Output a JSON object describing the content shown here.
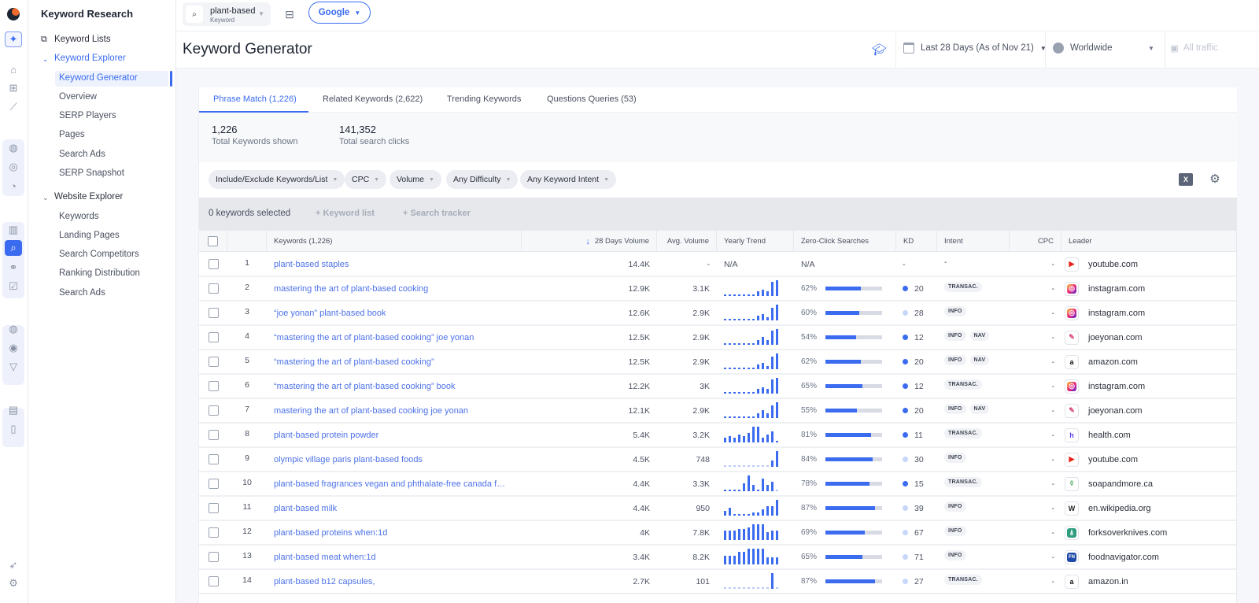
{
  "app": {
    "section_title": "Keyword Research"
  },
  "rail": {
    "icons": [
      "logo",
      "ai-sparkle-icon",
      "home-icon",
      "dashboard-add-icon",
      "trend-chart-icon",
      "globe-icon",
      "globe-trend-icon",
      "pie-chart-icon",
      "bar-chart-icon",
      "keyword-research-icon",
      "link-icon",
      "report-check-icon",
      "globe-search-icon",
      "search-target-icon",
      "funnel-icon",
      "report-chart-icon",
      "clipboard-icon",
      "rocket-icon",
      "settings-icon"
    ]
  },
  "nav": {
    "keyword_lists": "Keyword Lists",
    "keyword_explorer": "Keyword Explorer",
    "keyword_explorer_items": [
      "Keyword Generator",
      "Overview",
      "SERP Players",
      "Pages",
      "Search Ads",
      "SERP Snapshot"
    ],
    "website_explorer": "Website Explorer",
    "website_explorer_items": [
      "Keywords",
      "Landing Pages",
      "Search Competitors",
      "Ranking Distribution",
      "Search Ads"
    ],
    "active_item": "Keyword Generator"
  },
  "topbar": {
    "keyword_value": "plant-based",
    "keyword_label": "Keyword",
    "engine": "Google"
  },
  "header": {
    "title": "Keyword Generator",
    "date_range": "Last 28 Days (As of Nov 21)",
    "location": "Worldwide",
    "traffic": "All traffic"
  },
  "tabs": [
    {
      "label": "Phrase Match (1,226)",
      "active": true
    },
    {
      "label": "Related Keywords (2,622)",
      "active": false
    },
    {
      "label": "Trending Keywords",
      "active": false
    },
    {
      "label": "Questions Queries (53)",
      "active": false
    }
  ],
  "stats": [
    {
      "value": "1,226",
      "label": "Total Keywords shown"
    },
    {
      "value": "141,352",
      "label": "Total search clicks"
    }
  ],
  "filters": [
    "Include/Exclude Keywords/List",
    "CPC",
    "Volume",
    "Any Difficulty",
    "Any Keyword Intent"
  ],
  "selection": {
    "status": "0 keywords selected",
    "add_keyword_list": "+ Keyword list",
    "add_search_tracker": "+ Search tracker"
  },
  "table": {
    "columns": {
      "keywords": "Keywords (1,226)",
      "volume": "28 Days Volume",
      "avg_volume": "Avg. Volume",
      "trend": "Yearly Trend",
      "zero_click": "Zero-Click Searches",
      "kd": "KD",
      "intent": "Intent",
      "cpc": "CPC",
      "leader": "Leader"
    },
    "sort": {
      "column": "28 Days Volume",
      "direction": "desc"
    },
    "kd_colors": {
      "easy": "#3b6cf0",
      "medium": "#c7d6fb"
    },
    "rows": [
      {
        "n": "1",
        "keyword": "plant-based staples",
        "volume": "14.4K",
        "avg": "-",
        "trend": null,
        "trend_text": "N/A",
        "zero_click": null,
        "zero_click_text": "N/A",
        "kd": null,
        "kd_text": "-",
        "intent": [],
        "intent_text": "-",
        "cpc": "-",
        "leader": "youtube.com",
        "leader_icon": "youtube"
      },
      {
        "n": "2",
        "keyword": "mastering the art of plant-based cooking",
        "volume": "12.9K",
        "avg": "3.1K",
        "trend": [
          1,
          1,
          1,
          1,
          1,
          1,
          1,
          3,
          4,
          3,
          9,
          10
        ],
        "zero_click": 62,
        "kd": 20,
        "intent": [
          "TRANSAC."
        ],
        "cpc": "-",
        "leader": "instagram.com",
        "leader_icon": "instagram"
      },
      {
        "n": "3",
        "keyword": "“joe yonan” plant-based book",
        "volume": "12.6K",
        "avg": "2.9K",
        "trend": [
          1,
          1,
          1,
          1,
          1,
          1,
          1,
          3,
          4,
          2,
          8,
          10
        ],
        "zero_click": 60,
        "kd": 28,
        "intent": [
          "INFO"
        ],
        "cpc": "-",
        "leader": "instagram.com",
        "leader_icon": "instagram"
      },
      {
        "n": "4",
        "keyword": "“mastering the art of plant-based cooking” joe yonan",
        "volume": "12.5K",
        "avg": "2.9K",
        "trend": [
          1,
          1,
          1,
          1,
          1,
          1,
          1,
          3,
          5,
          3,
          9,
          10
        ],
        "zero_click": 54,
        "kd": 12,
        "intent": [
          "INFO",
          "NAV"
        ],
        "cpc": "-",
        "leader": "joeyonan.com",
        "leader_icon": "joeyonan"
      },
      {
        "n": "5",
        "keyword": "“mastering the art of plant-based cooking”",
        "volume": "12.5K",
        "avg": "2.9K",
        "trend": [
          1,
          1,
          1,
          1,
          1,
          1,
          1,
          3,
          4,
          2,
          8,
          10
        ],
        "zero_click": 62,
        "kd": 20,
        "intent": [
          "INFO",
          "NAV"
        ],
        "cpc": "-",
        "leader": "amazon.com",
        "leader_icon": "amazon"
      },
      {
        "n": "6",
        "keyword": "“mastering the art of plant-based cooking” book",
        "volume": "12.2K",
        "avg": "3K",
        "trend": [
          1,
          1,
          1,
          1,
          1,
          1,
          1,
          3,
          4,
          3,
          9,
          10
        ],
        "zero_click": 65,
        "kd": 12,
        "intent": [
          "TRANSAC."
        ],
        "cpc": "-",
        "leader": "instagram.com",
        "leader_icon": "instagram"
      },
      {
        "n": "7",
        "keyword": "mastering the art of plant-based cooking joe yonan",
        "volume": "12.1K",
        "avg": "2.9K",
        "trend": [
          1,
          1,
          1,
          1,
          1,
          1,
          1,
          3,
          5,
          3,
          8,
          10
        ],
        "zero_click": 55,
        "kd": 20,
        "intent": [
          "INFO",
          "NAV"
        ],
        "cpc": "-",
        "leader": "joeyonan.com",
        "leader_icon": "joeyonan"
      },
      {
        "n": "8",
        "keyword": "plant-based protein powder",
        "volume": "5.4K",
        "avg": "3.2K",
        "trend": [
          3,
          4,
          3,
          5,
          4,
          6,
          10,
          10,
          3,
          5,
          7,
          1
        ],
        "zero_click": 81,
        "kd": 11,
        "intent": [
          "TRANSAC."
        ],
        "cpc": "-",
        "leader": "health.com",
        "leader_icon": "health"
      },
      {
        "n": "9",
        "keyword": "olympic village paris plant-based foods",
        "volume": "4.5K",
        "avg": "748",
        "trend": [
          0,
          0,
          0,
          0,
          0,
          0,
          0,
          0,
          0,
          0,
          4,
          10
        ],
        "zero_click": 84,
        "kd": 30,
        "intent": [
          "INFO"
        ],
        "cpc": "-",
        "leader": "youtube.com",
        "leader_icon": "youtube"
      },
      {
        "n": "10",
        "keyword": "plant-based fragrances vegan and phthalate-free canada for c...",
        "volume": "4.4K",
        "avg": "3.3K",
        "trend": [
          1,
          1,
          1,
          1,
          5,
          10,
          4,
          1,
          8,
          4,
          6,
          0
        ],
        "zero_click": 78,
        "kd": 15,
        "intent": [
          "TRANSAC."
        ],
        "cpc": "-",
        "leader": "soapandmore.ca",
        "leader_icon": "soapandmore"
      },
      {
        "n": "11",
        "keyword": "plant-based milk",
        "volume": "4.4K",
        "avg": "950",
        "trend": [
          3,
          5,
          1,
          1,
          1,
          1,
          2,
          2,
          4,
          6,
          6,
          10
        ],
        "zero_click": 87,
        "kd": 39,
        "intent": [
          "INFO"
        ],
        "cpc": "-",
        "leader": "en.wikipedia.org",
        "leader_icon": "wikipedia"
      },
      {
        "n": "12",
        "keyword": "plant-based proteins when:1d",
        "volume": "4K",
        "avg": "7.8K",
        "trend": [
          6,
          6,
          6,
          7,
          7,
          8,
          10,
          10,
          10,
          5,
          6,
          6
        ],
        "zero_click": 69,
        "kd": 67,
        "intent": [
          "INFO"
        ],
        "cpc": "-",
        "leader": "forksoverknives.com",
        "leader_icon": "forksoverknives"
      },
      {
        "n": "13",
        "keyword": "plant-based meat when:1d",
        "volume": "3.4K",
        "avg": "8.2K",
        "trend": [
          5,
          5,
          5,
          7,
          7,
          9,
          9,
          9,
          9,
          4,
          4,
          4
        ],
        "zero_click": 65,
        "kd": 71,
        "intent": [
          "INFO"
        ],
        "cpc": "-",
        "leader": "foodnavigator.com",
        "leader_icon": "foodnavigator"
      },
      {
        "n": "14",
        "keyword": "plant-based b12 capsules,",
        "volume": "2.7K",
        "avg": "101",
        "trend": [
          0,
          0,
          0,
          0,
          0,
          0,
          0,
          0,
          0,
          0,
          10,
          0
        ],
        "zero_click": 87,
        "kd": 27,
        "intent": [
          "TRANSAC."
        ],
        "cpc": "-",
        "leader": "amazon.in",
        "leader_icon": "amazon"
      }
    ]
  }
}
